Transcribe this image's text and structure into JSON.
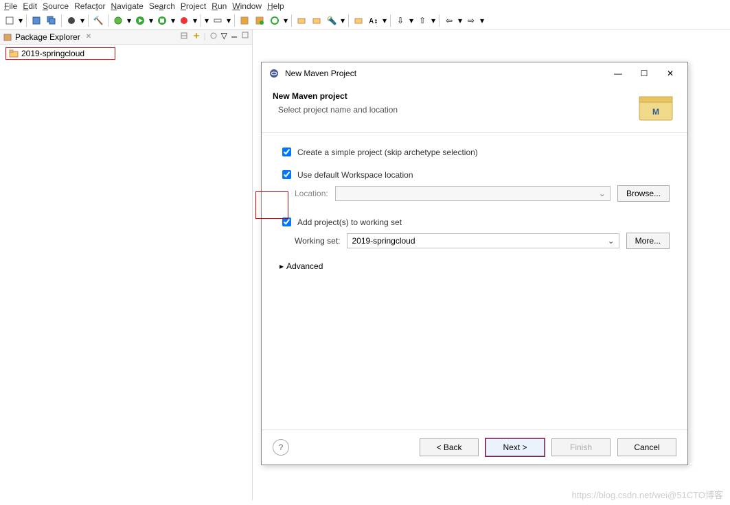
{
  "menu": {
    "file": "File",
    "edit": "Edit",
    "source": "Source",
    "refactor": "Refactor",
    "navigate": "Navigate",
    "search": "Search",
    "project": "Project",
    "run": "Run",
    "window": "Window",
    "help": "Help"
  },
  "explorer": {
    "title": "Package Explorer",
    "close_glyph": "✕",
    "project": "2019-springcloud"
  },
  "dialog": {
    "window_title": "New Maven Project",
    "banner_title": "New Maven project",
    "banner_subtitle": "Select project name and location",
    "banner_icon_label": "M",
    "checkbox_simple": "Create a simple project (skip archetype selection)",
    "checkbox_workspace": "Use default Workspace location",
    "location_label": "Location:",
    "browse_label": "Browse...",
    "checkbox_workingset": "Add project(s) to working set",
    "workingset_label": "Working set:",
    "workingset_value": "2019-springcloud",
    "more_label": "More...",
    "advanced_label": "Advanced",
    "back_label": "< Back",
    "next_label": "Next >",
    "finish_label": "Finish",
    "cancel_label": "Cancel",
    "help_glyph": "?"
  },
  "watermark": "https://blog.csdn.net/wei@51CTO博客"
}
